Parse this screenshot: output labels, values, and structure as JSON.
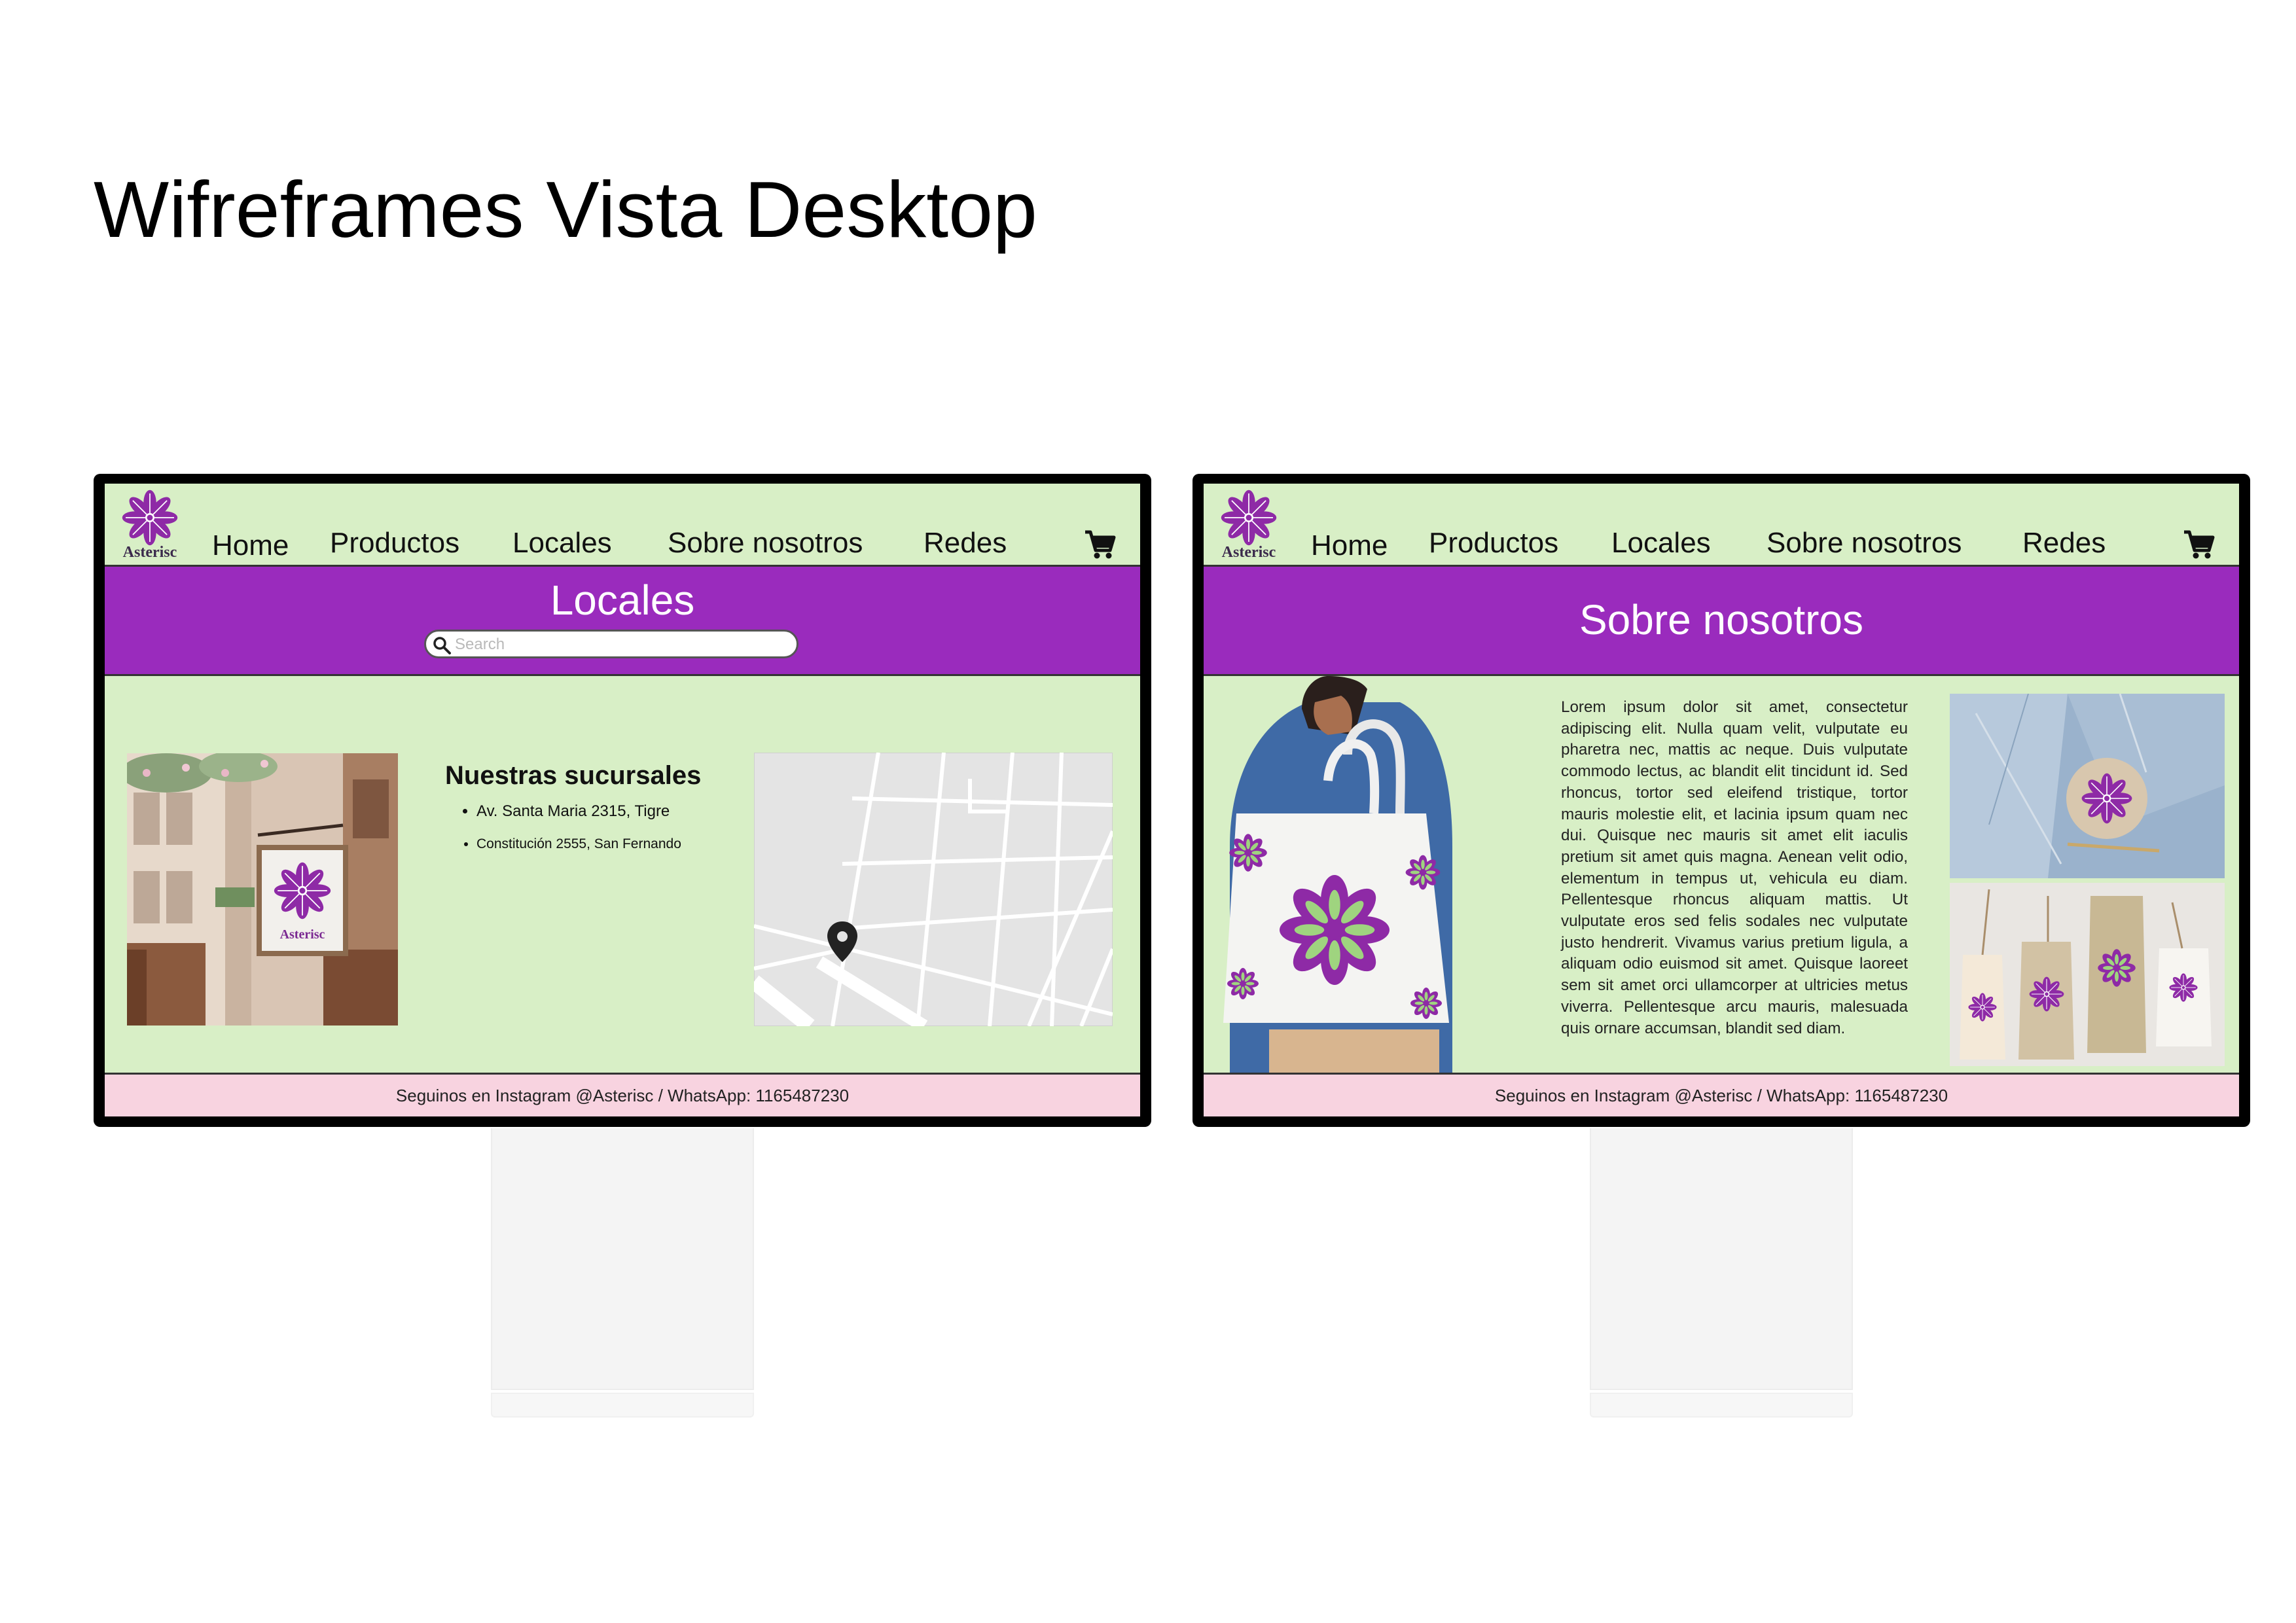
{
  "page": {
    "title": "Wifreframes Vista Desktop"
  },
  "colors": {
    "content_bg": "#d8efc6",
    "banner": "#9a2bbd",
    "footer": "#f8d3e0",
    "logo_purple": "#8e2aa6"
  },
  "nav": {
    "logo_text": "Asterisc",
    "items": [
      "Home",
      "Productos",
      "Locales",
      "Sobre nosotros",
      "Redes"
    ],
    "cart_icon": "shopping-cart-icon"
  },
  "screens": {
    "locales": {
      "banner_title": "Locales",
      "search_placeholder": "Search",
      "section_title": "Nuestras sucursales",
      "branches": [
        "Av. Santa Maria 2315, Tigre",
        "Constitución 2555, San Fernando"
      ],
      "footer": "Seguinos en Instagram @Asterisc / WhatsApp: 1165487230"
    },
    "sobre": {
      "banner_title": "Sobre nosotros",
      "body": "Lorem ipsum dolor sit amet, consectetur adipiscing elit. Nulla quam velit, vulputate eu pharetra nec, mattis ac neque. Duis vulputate commodo lectus, ac blandit elit tincidunt id. Sed rhoncus, tortor sed eleifend tristique, tortor mauris molestie elit, et lacinia ipsum quam nec dui. Quisque nec mauris sit amet elit iaculis pretium sit amet quis magna. Aenean velit odio, elementum in tempus ut, vehicula eu diam. Pellentesque rhoncus aliquam mattis. Ut vulputate eros sed felis sodales nec vulputate justo hendrerit. Vivamus varius pretium ligula, a aliquam odio euismod sit amet. Quisque laoreet sem sit amet orci ullamcorper at ultricies metus viverra. Pellentesque arcu mauris, malesuada quis ornare accumsan, blandit sed diam.",
      "footer": "Seguinos en Instagram @Asterisc / WhatsApp: 1165487230"
    }
  }
}
